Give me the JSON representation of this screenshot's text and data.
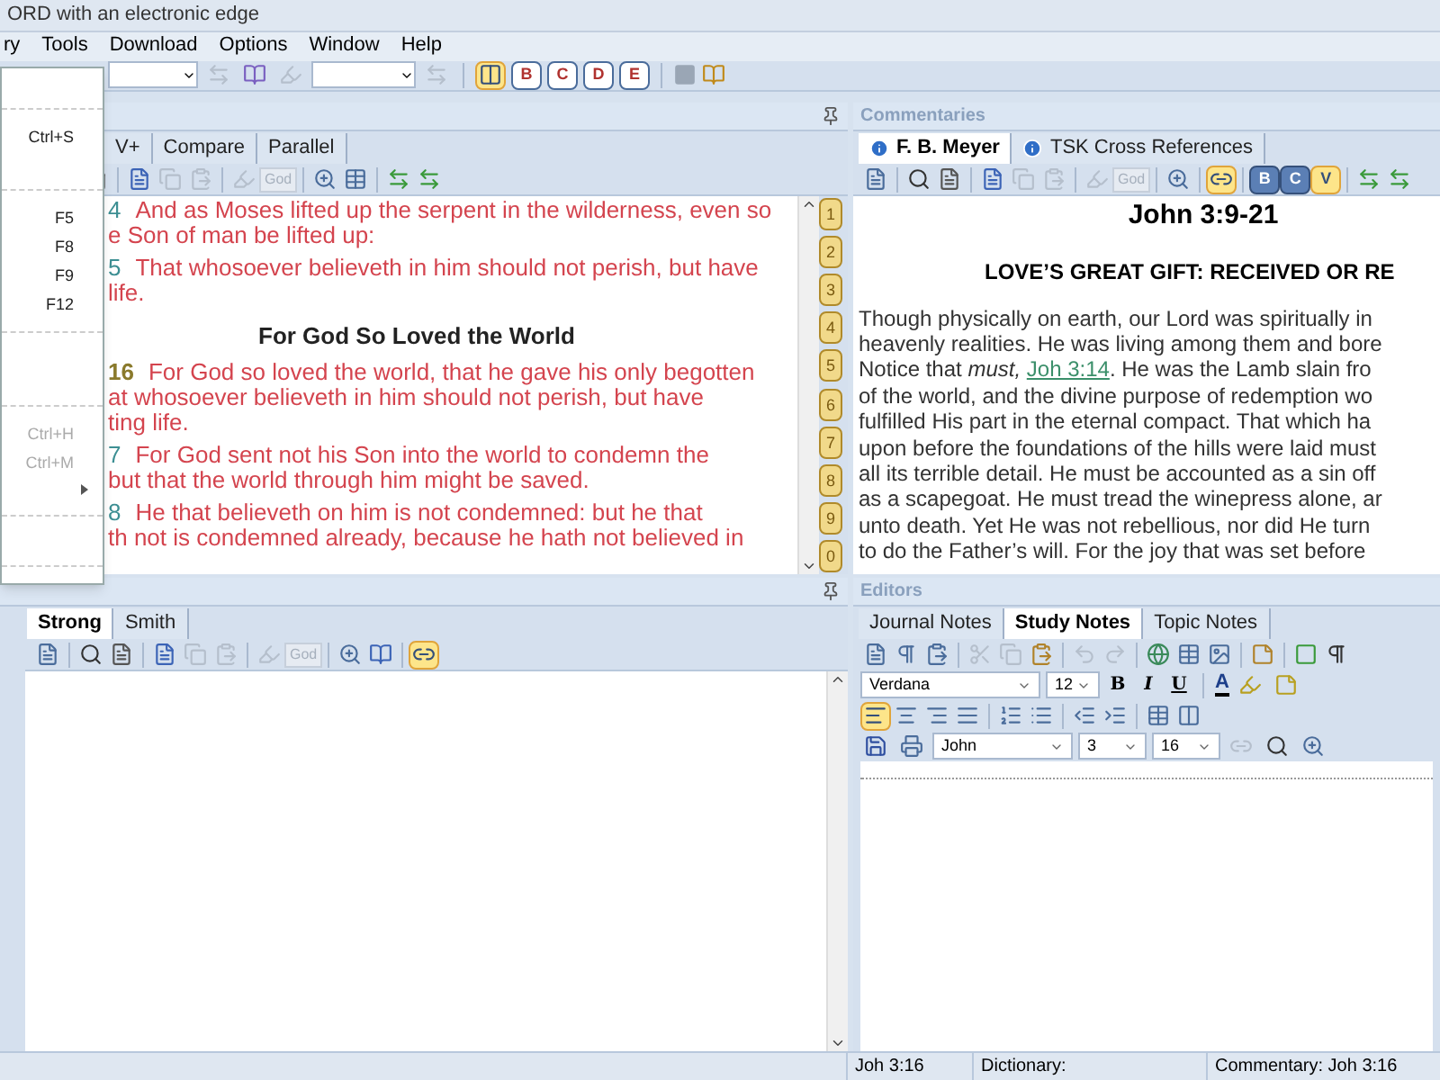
{
  "window": {
    "title": "ORD with an electronic edge"
  },
  "menu_bar": [
    "ry",
    "Tools",
    "Download",
    "Options",
    "Window",
    "Help"
  ],
  "open_menu": {
    "items": [
      {
        "kind": "gap"
      },
      {
        "kind": "separator"
      },
      {
        "kind": "item",
        "shortcut": "Ctrl+S",
        "disabled": false
      },
      {
        "kind": "gap"
      },
      {
        "kind": "separator"
      },
      {
        "kind": "item",
        "shortcut": "F5",
        "disabled": false
      },
      {
        "kind": "item",
        "shortcut": "F8",
        "disabled": false
      },
      {
        "kind": "item",
        "shortcut": "F9",
        "disabled": false
      },
      {
        "kind": "item",
        "shortcut": "F12",
        "disabled": false
      },
      {
        "kind": "separator"
      },
      {
        "kind": "gap"
      },
      {
        "kind": "gap"
      },
      {
        "kind": "separator"
      },
      {
        "kind": "item",
        "shortcut": "Ctrl+H",
        "disabled": true
      },
      {
        "kind": "item",
        "shortcut": "Ctrl+M",
        "disabled": true
      },
      {
        "kind": "submenu"
      },
      {
        "kind": "separator"
      },
      {
        "kind": "gap"
      },
      {
        "kind": "separator"
      }
    ]
  },
  "toolbar": {
    "letter_buttons": [
      {
        "label": "B"
      },
      {
        "label": "C"
      },
      {
        "label": "D"
      },
      {
        "label": "E"
      }
    ]
  },
  "bible": {
    "tabs": [
      {
        "label": "V+",
        "selected": false
      },
      {
        "label": "Compare",
        "selected": false
      },
      {
        "label": "Parallel",
        "selected": false
      }
    ],
    "toolbar_god": "God",
    "passage": [
      {
        "kind": "verse",
        "number": "4",
        "selected": false,
        "lines": [
          "And as Moses lifted up the serpent in the wilderness, even so",
          "e Son of man be lifted up:"
        ]
      },
      {
        "kind": "verse",
        "number": "5",
        "selected": false,
        "lines": [
          "That whosoever believeth in him should not perish, but have",
          "life."
        ]
      },
      {
        "kind": "heading",
        "text": "For God So Loved the World"
      },
      {
        "kind": "verse",
        "number": "16",
        "selected": true,
        "lines": [
          "For God so loved the world, that he gave his only begotten",
          "at whosoever believeth in him should not perish, but have",
          "ting life."
        ]
      },
      {
        "kind": "verse",
        "number": "7",
        "selected": false,
        "lines": [
          "For God sent not his Son into the world to condemn the",
          "but that the world through him might be saved."
        ]
      },
      {
        "kind": "verse",
        "number": "8",
        "selected": false,
        "lines": [
          "He that believeth on him is not condemned: but he that",
          "th not is condemned already, because he hath not believed in"
        ]
      }
    ],
    "chapter_tabs": [
      "1",
      "2",
      "3",
      "4",
      "5",
      "6",
      "7",
      "8",
      "9",
      "0"
    ]
  },
  "commentaries": {
    "header": "Commentaries",
    "tabs": [
      {
        "label": "F. B. Meyer",
        "selected": true
      },
      {
        "label": "TSK Cross References",
        "selected": false
      }
    ],
    "toolbar_god": "God",
    "letter_buttons": [
      {
        "label": "B",
        "selected": false
      },
      {
        "label": "C",
        "selected": false
      },
      {
        "label": "V",
        "selected": true
      }
    ],
    "title": "John 3:9-21",
    "heading": "LOVE’S GREAT GIFT: RECEIVED OR RE",
    "lines": [
      {
        "text": "Though physically on earth, our Lord was spiritually in"
      },
      {
        "text": "heavenly realities. He was living among them and bore"
      },
      {
        "text": "Notice that *must,* ",
        "link": "Joh 3:14",
        "after": ". He was the Lamb slain fro"
      },
      {
        "text": "of the world, and the divine purpose of redemption wo"
      },
      {
        "text": "fulfilled His part in the eternal compact. That which ha"
      },
      {
        "text": "upon before the foundations of the hills were laid must"
      },
      {
        "text": "all its terrible detail. He must be accounted as a sin off"
      },
      {
        "text": "as a scapegoat. He must tread the winepress alone, ar"
      },
      {
        "text": "unto death. Yet He was not rebellious, nor did He turn"
      },
      {
        "text": "to do the Father’s will. For the joy that was set before"
      }
    ]
  },
  "dictionaries": {
    "tabs": [
      {
        "label": "Strong",
        "selected": true
      },
      {
        "label": "Smith",
        "selected": false
      }
    ],
    "toolbar_god": "God"
  },
  "editors": {
    "header": "Editors",
    "tabs": [
      {
        "label": "Journal Notes",
        "selected": false
      },
      {
        "label": "Study Notes",
        "selected": true
      },
      {
        "label": "Topic Notes",
        "selected": false
      }
    ],
    "format_buttons": [
      "B",
      "I",
      "U"
    ],
    "font_color": "A",
    "font": "Verdana",
    "size": "12",
    "book": "John",
    "chapter": "3",
    "verse": "16"
  },
  "status_bar": [
    "Joh 3:16",
    "Dictionary:",
    "Commentary: Joh 3:16"
  ]
}
